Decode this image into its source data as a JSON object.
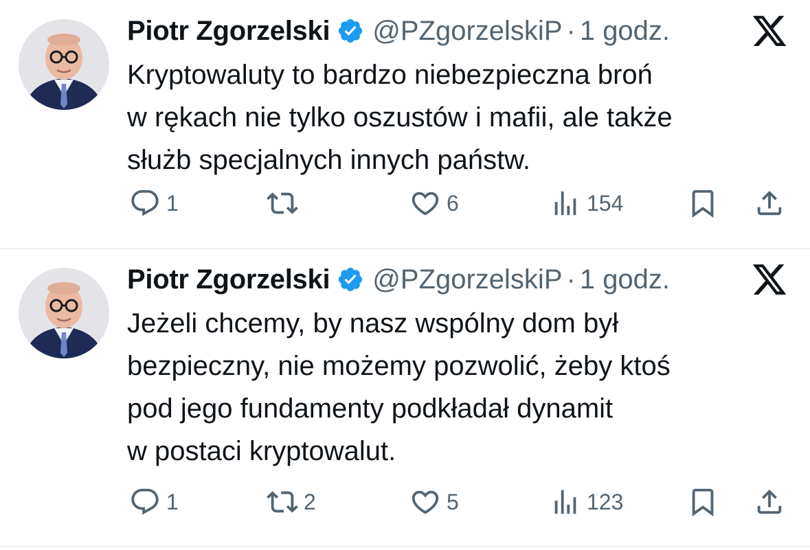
{
  "tweets": [
    {
      "author_name": "Piotr Zgorzelski",
      "handle": "@PZgorzelskiP",
      "separator": "·",
      "time": "1 godz.",
      "text_lines": [
        "Kryptowaluty to bardzo niebezpieczna broń",
        "w rękach nie tylko oszustów i mafii, ale także",
        "służb specjalnych innych państw."
      ],
      "replies": "1",
      "reposts": "",
      "likes": "6",
      "views": "154"
    },
    {
      "author_name": "Piotr Zgorzelski",
      "handle": "@PZgorzelskiP",
      "separator": "·",
      "time": "1 godz.",
      "text_lines": [
        "Jeżeli chcemy, by nasz wspólny dom był",
        "bezpieczny, nie możemy pozwolić, żeby ktoś",
        "pod jego fundamenty podkładał dynamit",
        "w postaci kryptowalut."
      ],
      "replies": "1",
      "reposts": "2",
      "likes": "5",
      "views": "123"
    }
  ],
  "icons": {
    "verified": "verified-badge-icon",
    "platform": "x-logo-icon",
    "reply": "reply-icon",
    "repost": "repost-icon",
    "like": "heart-icon",
    "views": "views-icon",
    "bookmark": "bookmark-icon",
    "share": "share-icon"
  },
  "colors": {
    "text": "#0f1419",
    "muted": "#536471",
    "verified": "#1d9bf0",
    "divider": "#eff3f4"
  }
}
